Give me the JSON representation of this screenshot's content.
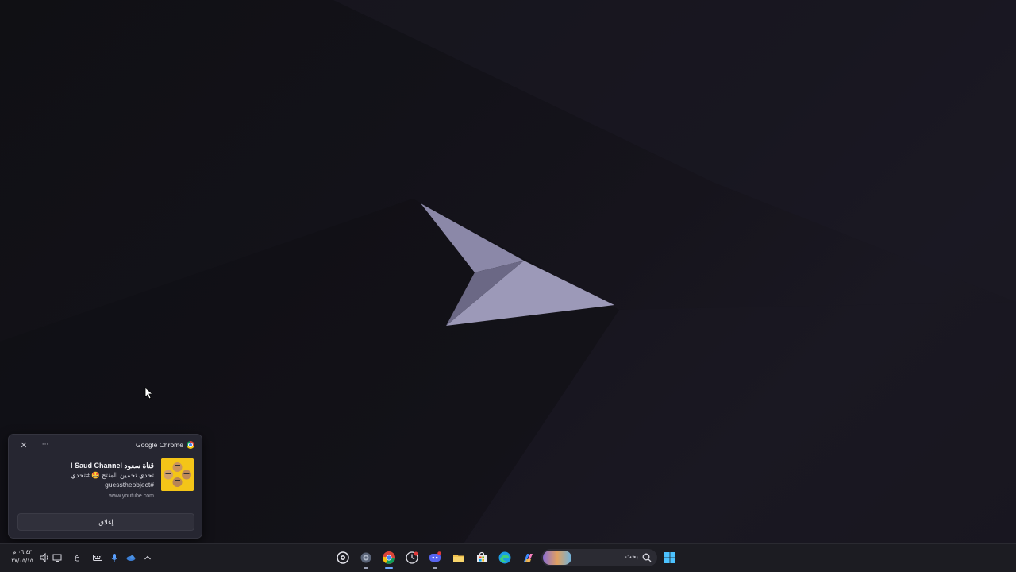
{
  "notification": {
    "app_name": "Google Chrome",
    "close_symbol": "✕",
    "more_symbol": "···",
    "title": "قناة سعود l Saud Channel",
    "body": "تحدي تخمين المنتج 🤩 #تحدي\n#guesstheobject",
    "url": "www.youtube.com",
    "action_label": "إغلاق",
    "icons": {
      "app": "chrome-icon",
      "thumbnail": "channel-thumbnail-image"
    }
  },
  "taskbar": {
    "clock_time": "٠٦:٤٣ م",
    "clock_date": "٢٧/٠٥/١٥",
    "language_indicator": "ع",
    "search_placeholder": "بحث",
    "tray_icons": [
      "speaker-icon",
      "display-icon",
      "keyboard-icon",
      "microphone-icon",
      "onedrive-icon",
      "chevron-up-icon"
    ],
    "pinned_apps": [
      "steam-icon",
      "settings-icon",
      "chrome-icon",
      "clock-app-icon",
      "discord-icon",
      "file-explorer-icon",
      "microsoft-store-icon",
      "edge-icon",
      "copilot-icon"
    ],
    "start_icon": "windows-start-icon"
  },
  "colors": {
    "desktop_bg": "#131219",
    "taskbar_bg": "#1c1c22",
    "notification_bg": "#262631",
    "logo": "#8a87a6"
  }
}
